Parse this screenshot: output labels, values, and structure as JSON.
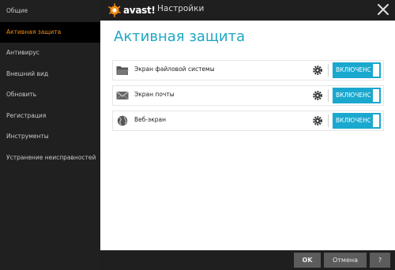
{
  "window": {
    "title": "Настройки",
    "brand": "avast!"
  },
  "sidebar": {
    "items": [
      {
        "label": "Общие"
      },
      {
        "label": "Активная защита",
        "active": true
      },
      {
        "label": "Антивирус"
      },
      {
        "label": "Внешний вид"
      },
      {
        "label": "Обновить"
      },
      {
        "label": "Регистрация"
      },
      {
        "label": "Инструменты"
      },
      {
        "label": "Устранение неисправностей"
      }
    ]
  },
  "main": {
    "title": "Активная защита",
    "shields": [
      {
        "label": "Экран файловой системы",
        "icon": "folder-icon",
        "toggle": "ВКЛЮЧЕНО"
      },
      {
        "label": "Экран почты",
        "icon": "envelope-icon",
        "toggle": "ВКЛЮЧЕНО"
      },
      {
        "label": "Веб-экран",
        "icon": "globe-icon",
        "toggle": "ВКЛЮЧЕНО"
      }
    ]
  },
  "footer": {
    "ok": "OK",
    "cancel": "Отмена",
    "help": "?"
  },
  "colors": {
    "accent": "#1ea7c4",
    "toggle": "#1aa8cf",
    "active_nav": "#f28a12",
    "sidebar_bg": "#202020"
  }
}
